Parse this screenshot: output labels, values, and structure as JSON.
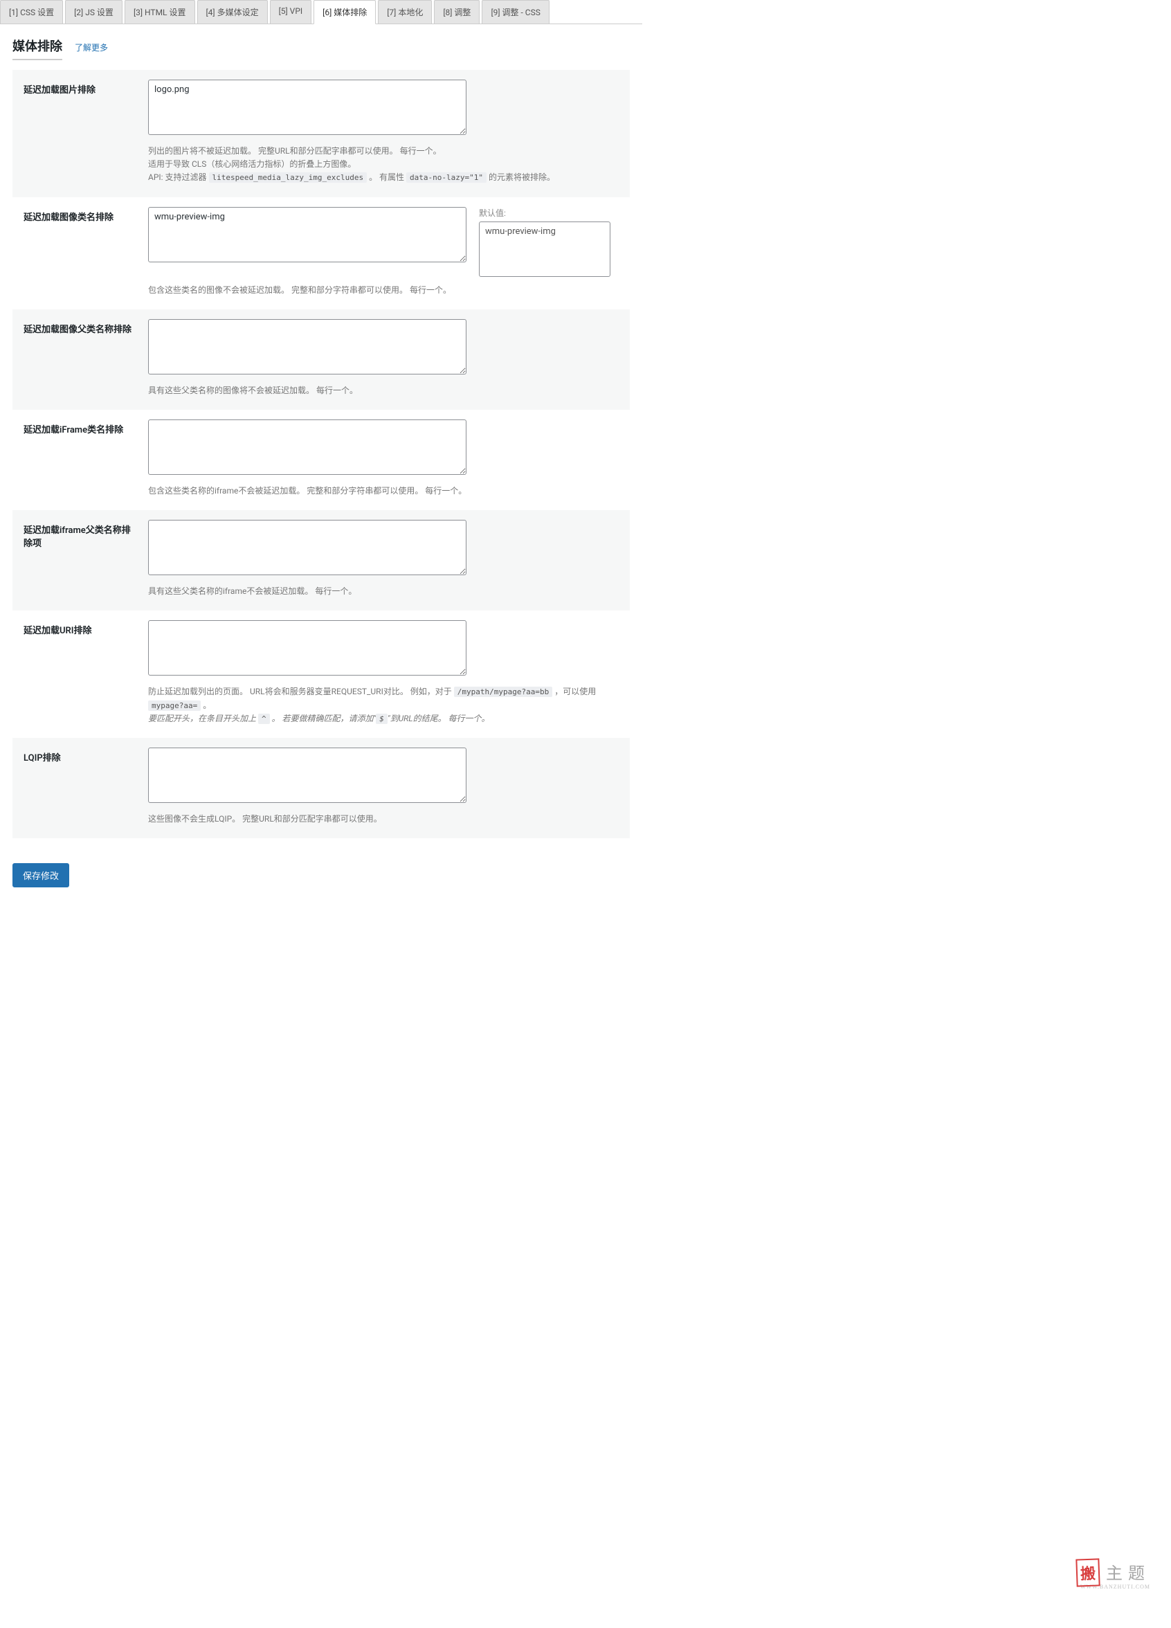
{
  "tabs": [
    {
      "label": "[1] CSS 设置"
    },
    {
      "label": "[2] JS 设置"
    },
    {
      "label": "[3] HTML 设置"
    },
    {
      "label": "[4] 多媒体设定"
    },
    {
      "label": "[5] VPI"
    },
    {
      "label": "[6] 媒体排除"
    },
    {
      "label": "[7] 本地化"
    },
    {
      "label": "[8] 调整"
    },
    {
      "label": "[9] 调整 - CSS"
    }
  ],
  "active_tab_index": 5,
  "section": {
    "title": "媒体排除",
    "more_link": "了解更多"
  },
  "rows": {
    "r0": {
      "label": "延迟加载图片排除",
      "value": "logo.png",
      "desc_a": "列出的图片将不被延迟加载。 完整URL和部分匹配字串都可以使用。 每行一个。",
      "desc_b": "适用于导致 CLS（核心网络活力指标）的折叠上方图像。",
      "desc_c_prefix": "API: 支持过滤器",
      "desc_c_code1": "litespeed_media_lazy_img_excludes",
      "desc_c_mid": "。 有属性",
      "desc_c_code2": "data-no-lazy=\"1\"",
      "desc_c_suffix": "的元素将被排除。"
    },
    "r1": {
      "label": "延迟加载图像类名排除",
      "value": "wmu-preview-img",
      "default_label": "默认值:",
      "default_value": "wmu-preview-img",
      "desc": "包含这些类名的图像不会被延迟加载。 完整和部分字符串都可以使用。 每行一个。"
    },
    "r2": {
      "label": "延迟加载图像父类名称排除",
      "value": "",
      "desc": "具有这些父类名称的图像将不会被延迟加载。 每行一个。"
    },
    "r3": {
      "label": "延迟加载iFrame类名排除",
      "value": "",
      "desc": "包含这些类名称的iframe不会被延迟加载。 完整和部分字符串都可以使用。 每行一个。"
    },
    "r4": {
      "label": "延迟加载iframe父类名称排除项",
      "value": "",
      "desc": "具有这些父类名称的iframe不会被延迟加载。 每行一个。"
    },
    "r5": {
      "label": "延迟加载URI排除",
      "value": "",
      "desc_a": "防止延迟加载列出的页面。 URL将会和服务器变量REQUEST_URI对比。 例如，对于",
      "desc_code1": "/mypath/mypage?aa=bb",
      "desc_mid": "，可以使用",
      "desc_code2": "mypage?aa=",
      "desc_suffix": "。",
      "desc_b_prefix": "要匹配开头，在条目开头加上",
      "desc_b_code1": "^",
      "desc_b_mid": "。 若要做精确匹配，请添加\"",
      "desc_b_code2": "$",
      "desc_b_end": "\"到URL的结尾。 每行一个。"
    },
    "r6": {
      "label": "LQIP排除",
      "value": "",
      "desc": "这些图像不会生成LQIP。 完整URL和部分匹配字串都可以使用。"
    }
  },
  "save_button": "保存修改",
  "watermark": {
    "stamp": "搬",
    "text": "主题",
    "sub": "WWW.BANZHUTI.COM"
  }
}
